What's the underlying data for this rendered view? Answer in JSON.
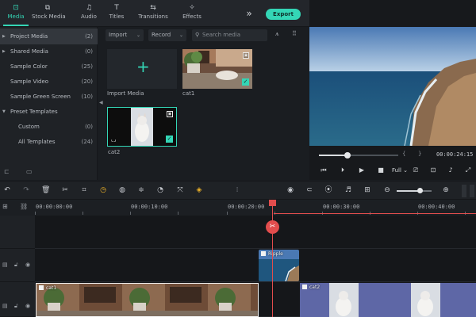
{
  "toolbar": {
    "tabs": [
      {
        "label": "Media",
        "icon": "folder-icon",
        "glyph": "⊡",
        "active": true
      },
      {
        "label": "Stock Media",
        "icon": "cloud-icon",
        "glyph": "⧉",
        "active": false
      },
      {
        "label": "Audio",
        "icon": "music-icon",
        "glyph": "♫",
        "active": false
      },
      {
        "label": "Titles",
        "icon": "text-icon",
        "glyph": "T",
        "active": false
      },
      {
        "label": "Transitions",
        "icon": "transition-icon",
        "glyph": "⇆",
        "active": false
      },
      {
        "label": "Effects",
        "icon": "effects-icon",
        "glyph": "✧",
        "active": false
      }
    ],
    "more_glyph": "»",
    "export_label": "Export"
  },
  "sidebar": {
    "items": [
      {
        "label": "Project Media",
        "count": "(2)",
        "caret": "▶",
        "indent": 0,
        "active": true
      },
      {
        "label": "Shared Media",
        "count": "(0)",
        "caret": "▶",
        "indent": 0,
        "active": false
      },
      {
        "label": "Sample Color",
        "count": "(25)",
        "caret": "",
        "indent": 1,
        "active": false
      },
      {
        "label": "Sample Video",
        "count": "(20)",
        "caret": "",
        "indent": 1,
        "active": false
      },
      {
        "label": "Sample Green Screen",
        "count": "(10)",
        "caret": "",
        "indent": 1,
        "active": false
      },
      {
        "label": "Preset Templates",
        "count": "",
        "caret": "▼",
        "indent": 0,
        "active": false
      },
      {
        "label": "Custom",
        "count": "(0)",
        "caret": "",
        "indent": 2,
        "active": false
      },
      {
        "label": "All Templates",
        "count": "(24)",
        "caret": "",
        "indent": 2,
        "active": false
      }
    ]
  },
  "media": {
    "import_dropdown": "Import",
    "record_dropdown": "Record",
    "search_placeholder": "Search media",
    "import_tile_label": "Import Media",
    "clips": [
      {
        "name": "cat1"
      },
      {
        "name": "cat2"
      }
    ]
  },
  "preview": {
    "timecode": "00:00:24:15",
    "progress": 0.36,
    "quality": "Full"
  },
  "timeline": {
    "ruler_labels": [
      "00:00:00:00",
      "00:00:10:00",
      "00:00:20:00",
      "00:00:30:00",
      "00:00:40:00"
    ],
    "zoom": 0.65,
    "clips": [
      {
        "name": "Ripple"
      },
      {
        "name": "cat1"
      },
      {
        "name": "cat2"
      }
    ]
  },
  "colors": {
    "accent": "#34d6b6",
    "playhead": "#e24d4d",
    "background": "#1a1d21"
  }
}
